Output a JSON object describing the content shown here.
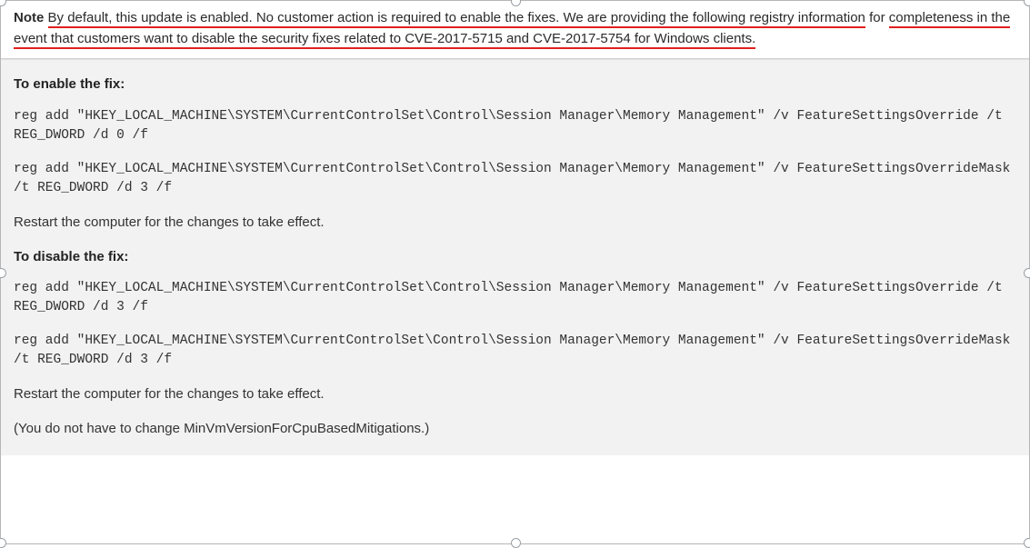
{
  "note": {
    "label": "Note",
    "underlined1": "By default, this update is enabled. No customer action is required to enable the fixes. We are providing the following registry information",
    "mid": " for ",
    "underlined2": "completeness in the event that customers want to disable the security fixes related to CVE-2017-5715 and CVE-2017-5754 for Windows clients."
  },
  "enable": {
    "title": "To enable the fix:",
    "cmd1": "reg add \"HKEY_LOCAL_MACHINE\\SYSTEM\\CurrentControlSet\\Control\\Session Manager\\Memory Management\" /v FeatureSettingsOverride /t REG_DWORD /d 0 /f",
    "cmd2": "reg add \"HKEY_LOCAL_MACHINE\\SYSTEM\\CurrentControlSet\\Control\\Session Manager\\Memory Management\" /v FeatureSettingsOverrideMask /t REG_DWORD /d 3 /f",
    "restart": "Restart the computer for the changes to take effect."
  },
  "disable": {
    "title": "To disable the fix:",
    "cmd1": "reg add \"HKEY_LOCAL_MACHINE\\SYSTEM\\CurrentControlSet\\Control\\Session Manager\\Memory Management\" /v FeatureSettingsOverride /t REG_DWORD /d 3 /f",
    "cmd2": "reg add \"HKEY_LOCAL_MACHINE\\SYSTEM\\CurrentControlSet\\Control\\Session Manager\\Memory Management\" /v FeatureSettingsOverrideMask /t REG_DWORD /d 3 /f",
    "restart": "Restart the computer for the changes to take effect.",
    "extra": "(You do not have to change MinVmVersionForCpuBasedMitigations.)"
  }
}
